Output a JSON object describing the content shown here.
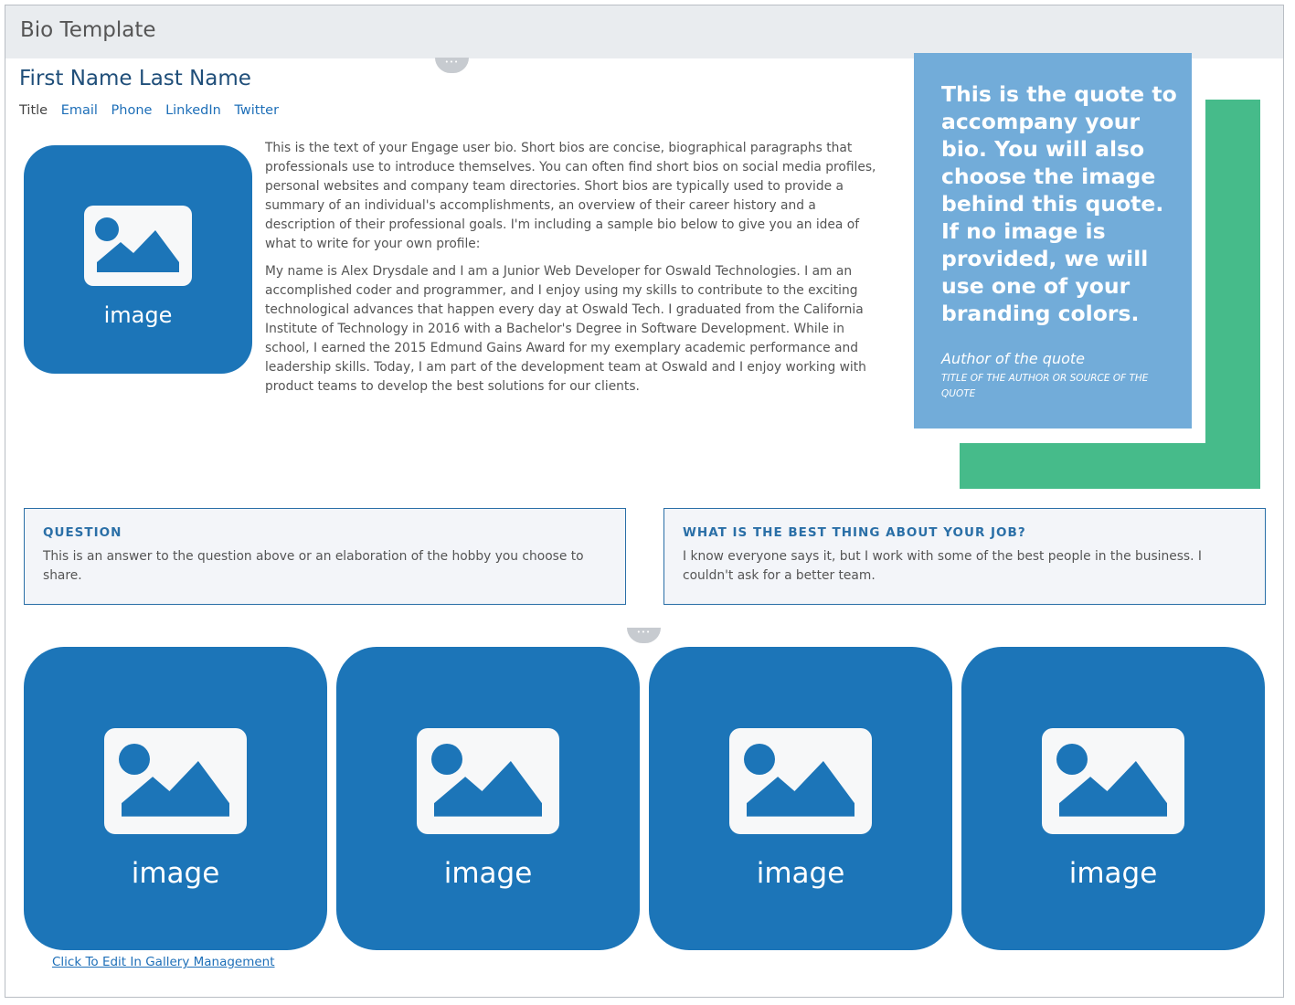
{
  "window": {
    "title": "Bio Template"
  },
  "profile": {
    "name": "First Name Last Name",
    "title_label": "Title",
    "links": [
      "Email",
      "Phone",
      "LinkedIn",
      "Twitter"
    ],
    "image_caption": "image"
  },
  "bio": {
    "paragraphs": [
      "This is the text of your Engage user bio. Short bios are concise, biographical paragraphs that professionals use to introduce themselves. You can often find short bios on social media profiles, personal websites and company team directories. Short bios are typically used to provide a summary of an individual's accomplishments, an overview of their career history and a description of their professional goals. I'm including a sample bio below to give you an idea of what to write for your own profile:",
      "My name is Alex Drysdale and I am a Junior Web Developer for Oswald Technologies. I am an accomplished coder and programmer, and I enjoy using my skills to contribute to the exciting technological advances that happen every day at Oswald Tech. I graduated from the California Institute of Technology in 2016 with a Bachelor's Degree in Software Development. While in school, I earned the 2015 Edmund Gains Award for my exemplary academic performance and leadership skills. Today, I am part of the development team at Oswald and I enjoy working with product teams to develop the best solutions for our clients."
    ]
  },
  "quote": {
    "text": "This is the quote to accompany your bio. You will also choose the image behind this quote. If no image is provided, we will use one of your branding colors.",
    "author": "Author of the quote",
    "source": "Title of the author or source of the quote"
  },
  "qa": [
    {
      "heading": "QUESTION",
      "answer": "This is an answer to the question above or an elaboration of the hobby you choose to share."
    },
    {
      "heading": "WHAT IS THE BEST THING ABOUT YOUR JOB?",
      "answer": "I know everyone says it, but I work with some of the best people in the business. I couldn't ask for a better team."
    }
  ],
  "gallery": {
    "captions": [
      "image",
      "image",
      "image",
      "image"
    ],
    "edit_link": "Click To Edit In Gallery Management"
  },
  "colors": {
    "brand_blue": "#1c75b8",
    "quote_bg": "#72acd9",
    "accent_green": "#46bb8a",
    "link": "#1e6fb8",
    "heading": "#1f4e79"
  },
  "icons": [
    "image-placeholder-icon",
    "more-options-icon"
  ]
}
